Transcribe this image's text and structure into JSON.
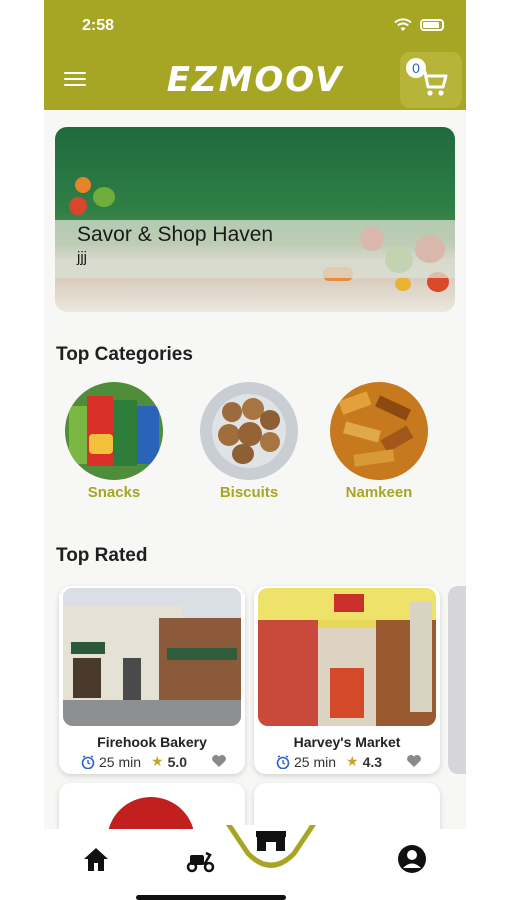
{
  "status": {
    "time": "2:58"
  },
  "header": {
    "brand": "EZMOOV",
    "cart_count": "0"
  },
  "banner": {
    "title": "Savor & Shop Haven",
    "subtitle": "jjj"
  },
  "top_categories": {
    "title": "Top Categories",
    "items": [
      {
        "label": "Snacks"
      },
      {
        "label": "Biscuits"
      },
      {
        "label": "Namkeen"
      }
    ]
  },
  "top_rated": {
    "title": "Top Rated",
    "items": [
      {
        "name": "Firehook Bakery",
        "time": "25 min",
        "rating": "5.0"
      },
      {
        "name": "Harvey's Market",
        "time": "25 min",
        "rating": "4.3"
      }
    ]
  },
  "colors": {
    "accent": "#a7a624",
    "rating_star": "#c9a227",
    "icon_blue": "#2d62c8"
  }
}
